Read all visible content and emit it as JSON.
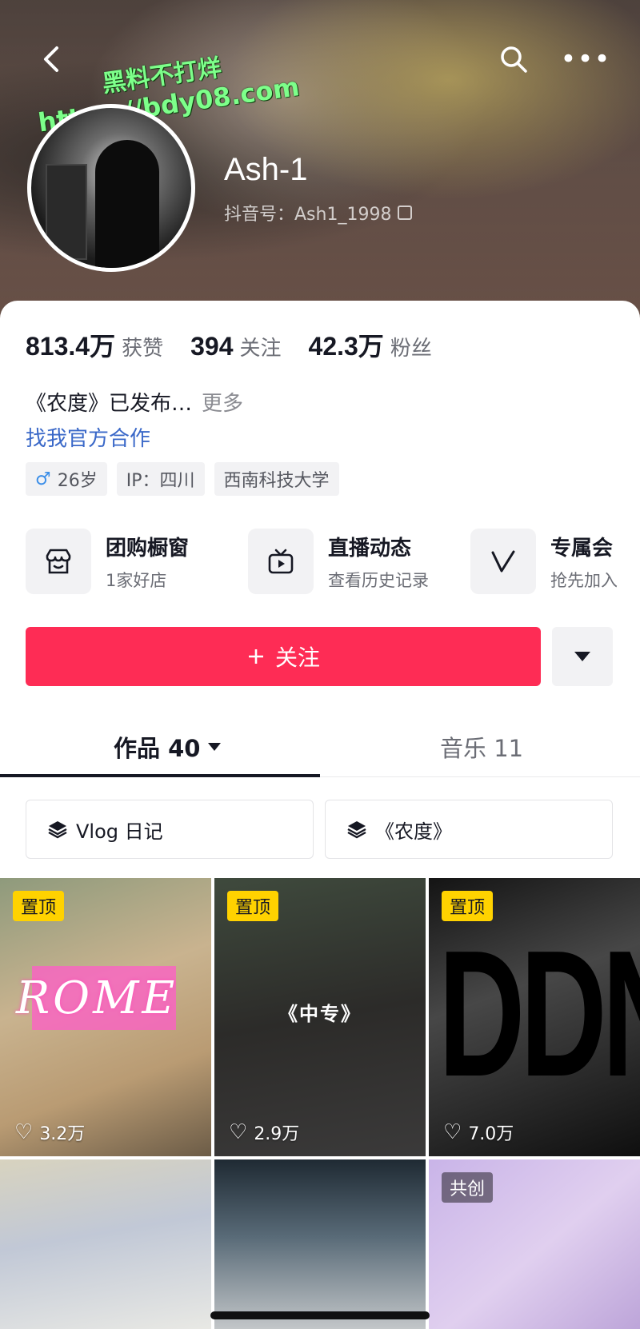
{
  "header": {
    "profile_name": "Ash-1",
    "douyin_id": "抖音号：Ash1_1998",
    "watermark_line1": "黑料不打烊",
    "watermark_line2": "https://bdy08.com"
  },
  "stats": [
    {
      "value": "813.4万",
      "label": "获赞"
    },
    {
      "value": "394",
      "label": "关注"
    },
    {
      "value": "42.3万",
      "label": "粉丝"
    }
  ],
  "bio": {
    "text": "《农度》已发布…",
    "more": "更多",
    "cooperation_link": "找我官方合作"
  },
  "tags": {
    "age": "26岁",
    "ip": "IP：四川",
    "school": "西南科技大学"
  },
  "services": [
    {
      "title": "团购橱窗",
      "subtitle": "1家好店",
      "icon": "store-icon"
    },
    {
      "title": "直播动态",
      "subtitle": "查看历史记录",
      "icon": "tv-icon"
    },
    {
      "title": "专属会",
      "subtitle": "抢先加入",
      "icon": "v-icon"
    }
  ],
  "actions": {
    "follow_label": "关注",
    "follow_color": "#fe2c55"
  },
  "tabs": [
    {
      "label": "作品 40"
    },
    {
      "label": "音乐 11"
    }
  ],
  "collections": [
    {
      "label": "Vlog 日记"
    },
    {
      "label": "《农度》"
    }
  ],
  "videos": [
    {
      "badge": "置顶",
      "likes": "3.2万",
      "overlay_text": "ROME"
    },
    {
      "badge": "置顶",
      "likes": "2.9万",
      "overlay_text": "《中专》"
    },
    {
      "badge": "置顶",
      "likes": "7.0万",
      "overlay_text": "DDN"
    },
    {
      "badge": "",
      "likes": "",
      "overlay_text": ""
    },
    {
      "badge": "",
      "likes": "",
      "overlay_text": ""
    },
    {
      "badge": "共创",
      "likes": "",
      "overlay_text": ""
    }
  ]
}
